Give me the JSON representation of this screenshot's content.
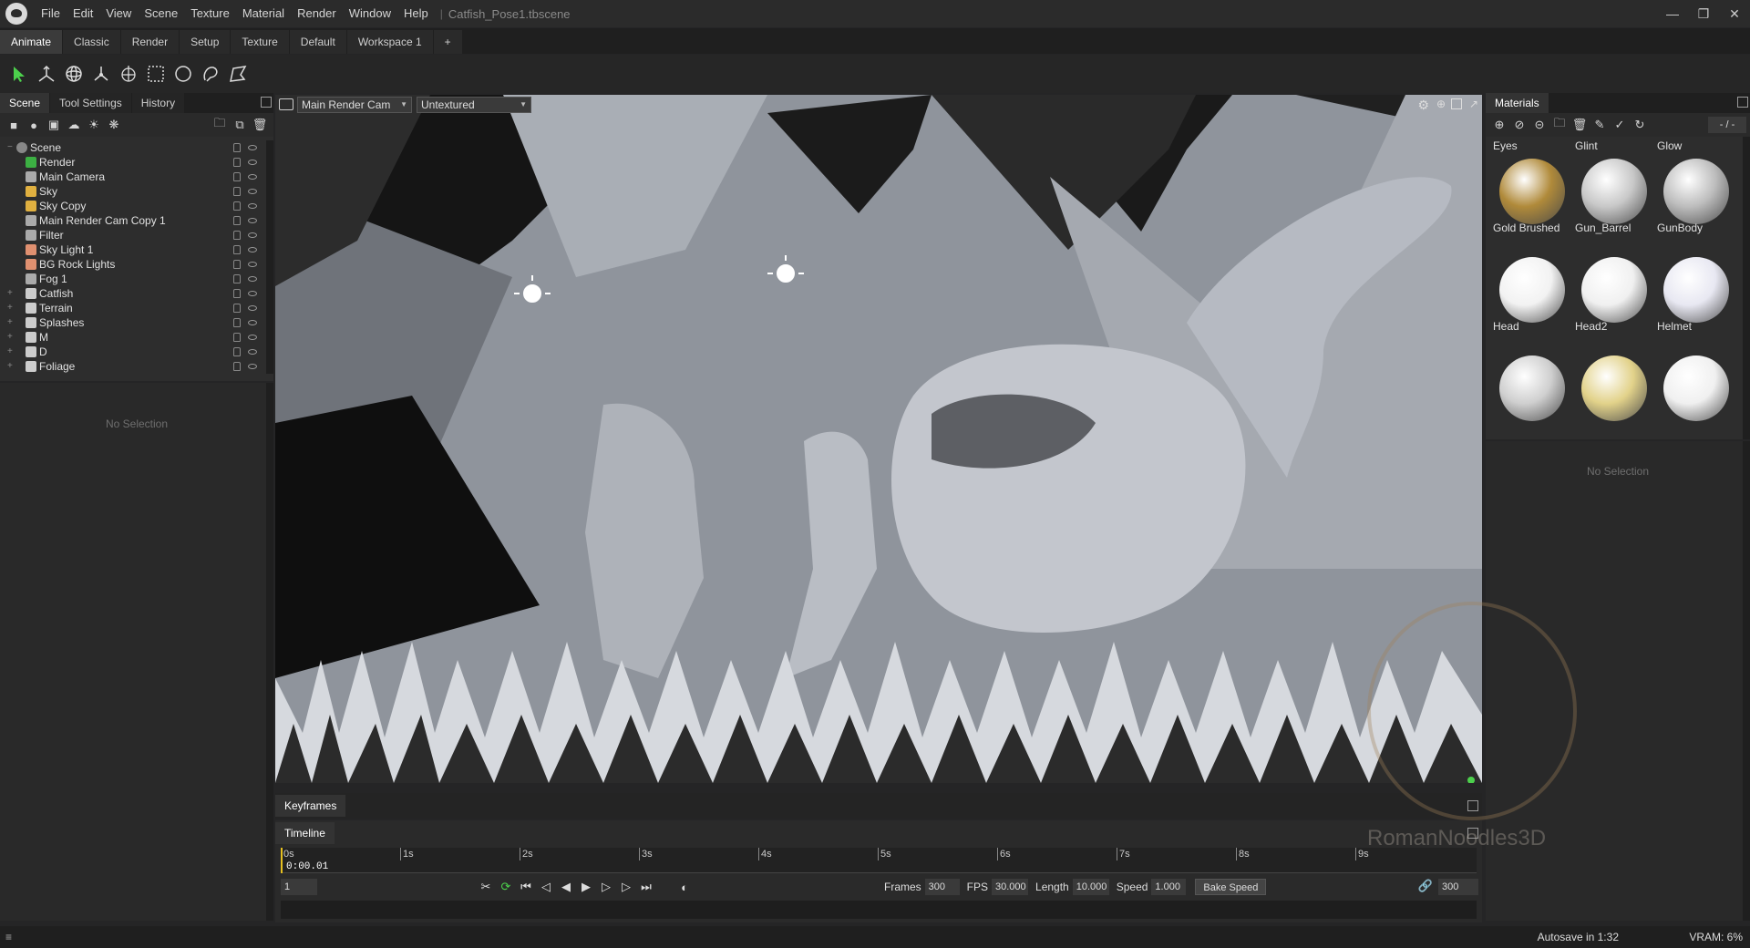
{
  "menu": {
    "items": [
      "File",
      "Edit",
      "View",
      "Scene",
      "Texture",
      "Material",
      "Render",
      "Window",
      "Help"
    ],
    "file_title": "Catfish_Pose1.tbscene"
  },
  "workspace_tabs": [
    "Animate",
    "Classic",
    "Render",
    "Setup",
    "Texture",
    "Default",
    "Workspace 1",
    "+"
  ],
  "left_tabs": [
    "Scene",
    "Tool Settings",
    "History"
  ],
  "scene_tree": [
    {
      "label": "Scene",
      "icon": "scene-icon",
      "color": "#888888"
    },
    {
      "label": "Render",
      "icon": "render-icon",
      "color": "#3cb043"
    },
    {
      "label": "Main Camera",
      "icon": "camera-icon",
      "color": "#aaaaaa"
    },
    {
      "label": "Sky",
      "icon": "sky-icon",
      "color": "#e0b040"
    },
    {
      "label": "Sky Copy",
      "icon": "sky-icon",
      "color": "#e0b040"
    },
    {
      "label": "Main Render Cam  Copy 1",
      "icon": "camera-icon",
      "color": "#aaaaaa"
    },
    {
      "label": "Filter",
      "icon": "filter-icon",
      "color": "#aaaaaa"
    },
    {
      "label": "Sky Light 1",
      "icon": "light-icon",
      "color": "#e09070"
    },
    {
      "label": "BG Rock Lights",
      "icon": "light-icon",
      "color": "#e09070"
    },
    {
      "label": "Fog 1",
      "icon": "fog-icon",
      "color": "#aaaaaa"
    },
    {
      "label": "Catfish",
      "icon": "object-icon",
      "color": "#cccccc"
    },
    {
      "label": "Terrain",
      "icon": "object-icon",
      "color": "#cccccc"
    },
    {
      "label": "Splashes",
      "icon": "object-icon",
      "color": "#cccccc"
    },
    {
      "label": "M",
      "icon": "object-icon",
      "color": "#cccccc"
    },
    {
      "label": "D",
      "icon": "object-icon",
      "color": "#cccccc"
    },
    {
      "label": "Foliage",
      "icon": "object-icon",
      "color": "#cccccc"
    }
  ],
  "left_no_selection": "No Selection",
  "viewport": {
    "camera": "Main Render Cam",
    "shading": "Untextured"
  },
  "materials": {
    "tab": "Materials",
    "page": "- / -",
    "top_labels": [
      "Eyes",
      "Glint",
      "Glow"
    ],
    "items": [
      {
        "name": "Gold Brushed",
        "color": "#b08a3a"
      },
      {
        "name": "Gun_Barrel",
        "color": "#c8c8c8"
      },
      {
        "name": "GunBody",
        "color": "#bdbdbd"
      },
      {
        "name": "Head",
        "color": "#f2f2f2"
      },
      {
        "name": "Head2",
        "color": "#f0f0f0"
      },
      {
        "name": "Helmet",
        "color": "#e8e8f2"
      },
      {
        "name": "",
        "color": "#cfcfcf"
      },
      {
        "name": "",
        "color": "#e2d28a"
      },
      {
        "name": "",
        "color": "#f0f0f0"
      }
    ],
    "no_selection": "No Selection"
  },
  "keyframes_tab": "Keyframes",
  "timeline": {
    "tab": "Timeline",
    "ticks": [
      "0s",
      "1s",
      "2s",
      "3s",
      "4s",
      "5s",
      "6s",
      "7s",
      "8s",
      "9s"
    ],
    "current_time": "0:00.01",
    "current_frame": "1",
    "frames_label": "Frames",
    "frames": "300",
    "fps_label": "FPS",
    "fps": "30.000",
    "length_label": "Length",
    "length": "10.000",
    "speed_label": "Speed",
    "speed": "1.000",
    "bake_label": "Bake Speed",
    "end_frame": "300"
  },
  "watermark": "RomanNoodles3D",
  "status": {
    "autosave": "Autosave in 1:32",
    "vram": "VRAM: 6%"
  }
}
